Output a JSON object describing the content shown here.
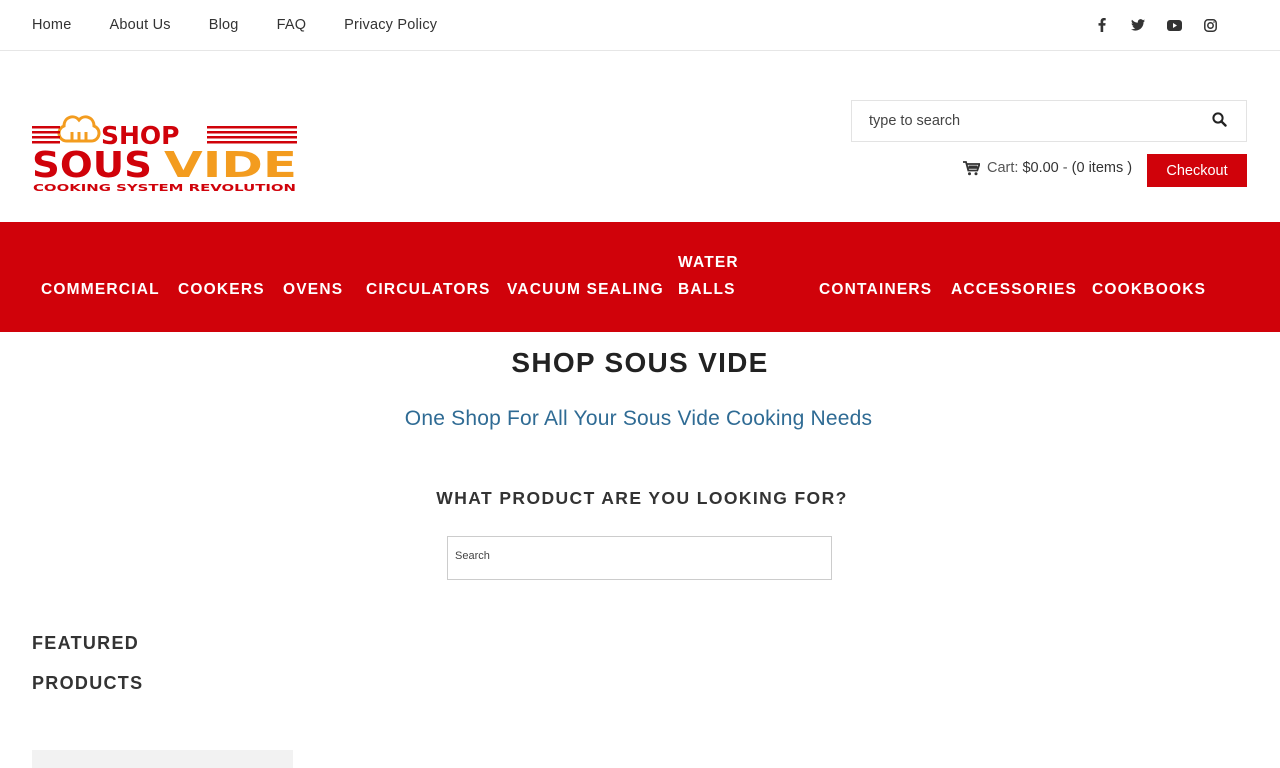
{
  "colors": {
    "brand_red": "#d0020a",
    "brand_orange": "#f39c1f",
    "subtitle_blue": "#2f6b94"
  },
  "top_nav": [
    "Home",
    "About Us",
    "Blog",
    "FAQ",
    "Privacy Policy"
  ],
  "social_icons": [
    "facebook-icon",
    "twitter-icon",
    "youtube-icon",
    "instagram-icon"
  ],
  "logo": {
    "line1": "SHOP",
    "line2a": "SOUS",
    "line2b": "VIDE",
    "tagline": "COOKING SYSTEM REVOLUTION"
  },
  "header": {
    "search_placeholder": "type to search",
    "cart_label": "Cart:",
    "cart_total": "$0.00",
    "cart_sep": "-",
    "cart_items": "(0 items )",
    "checkout_label": "Checkout"
  },
  "main_nav": [
    "COMMERCIAL",
    "COOKERS",
    "OVENS",
    "CIRCULATORS",
    "VACUUM SEALING",
    "WATER",
    "BALLS",
    "CONTAINERS",
    "ACCESSORIES",
    "COOKBOOKS"
  ],
  "hero": {
    "title": "SHOP SOUS VIDE",
    "subtitle": "One Shop For All Your Sous Vide Cooking Needs",
    "question": "WHAT PRODUCT ARE YOU LOOKING FOR?",
    "search_placeholder": "Search"
  },
  "featured": {
    "line1": "FEATURED",
    "line2": "PRODUCTS"
  }
}
